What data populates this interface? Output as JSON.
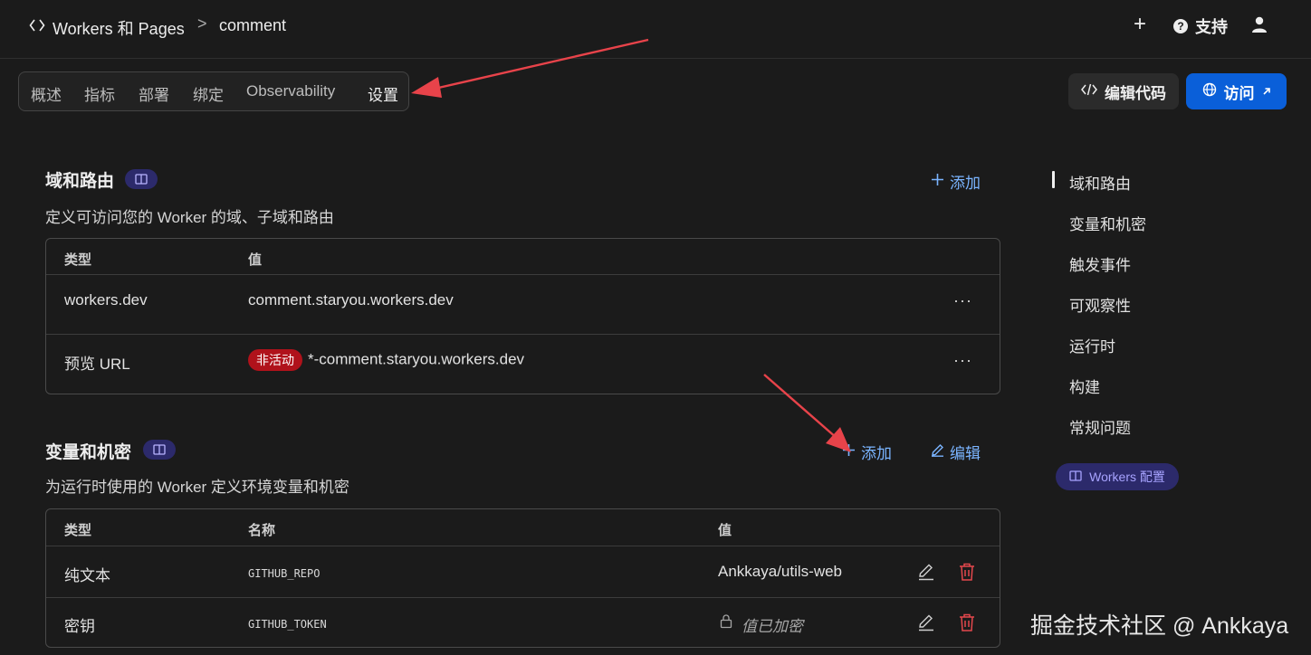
{
  "breadcrumb": {
    "section": "Workers 和 Pages",
    "separator": ">",
    "current": "comment"
  },
  "header": {
    "add_symbol": "+",
    "help_symbol": "?",
    "support_label": "支持"
  },
  "tabs": [
    {
      "label": "概述"
    },
    {
      "label": "指标"
    },
    {
      "label": "部署"
    },
    {
      "label": "绑定"
    },
    {
      "label": "Observability"
    },
    {
      "label": "设置",
      "active": true
    }
  ],
  "actions": {
    "edit_code_label": "编辑代码",
    "visit_label": "访问"
  },
  "domains": {
    "title": "域和路由",
    "description": "定义可访问您的 Worker 的域、子域和路由",
    "add_label": "添加",
    "columns": [
      "类型",
      "值"
    ],
    "rows": [
      {
        "type": "workers.dev",
        "badge": "",
        "value": "comment.staryou.workers.dev"
      },
      {
        "type": "预览 URL",
        "badge": "非活动",
        "value": "*-comment.staryou.workers.dev"
      }
    ],
    "more_symbol": "···"
  },
  "variables": {
    "title": "变量和机密",
    "description": "为运行时使用的 Worker 定义环境变量和机密",
    "add_label": "添加",
    "edit_label": "编辑",
    "columns": [
      "类型",
      "名称",
      "值"
    ],
    "rows": [
      {
        "type": "纯文本",
        "name": "GITHUB_REPO",
        "value": "Ankkaya/utils-web"
      },
      {
        "type": "密钥",
        "name": "GITHUB_TOKEN",
        "value": "值已加密"
      }
    ]
  },
  "side_nav": {
    "items": [
      "域和路由",
      "变量和机密",
      "触发事件",
      "可观察性",
      "运行时",
      "构建",
      "常规问题"
    ],
    "active_index": 0,
    "docs_pill": "Workers 配置"
  },
  "watermark": "掘金技术社区 @ Ankkaya",
  "colors": {
    "background": "#1b1b1b",
    "primary_button": "#0a5fd9",
    "link": "#7ab4ff",
    "inactive_badge": "#b0121b",
    "delete_icon": "#e5484d",
    "annotation_arrow": "#e8434a"
  }
}
